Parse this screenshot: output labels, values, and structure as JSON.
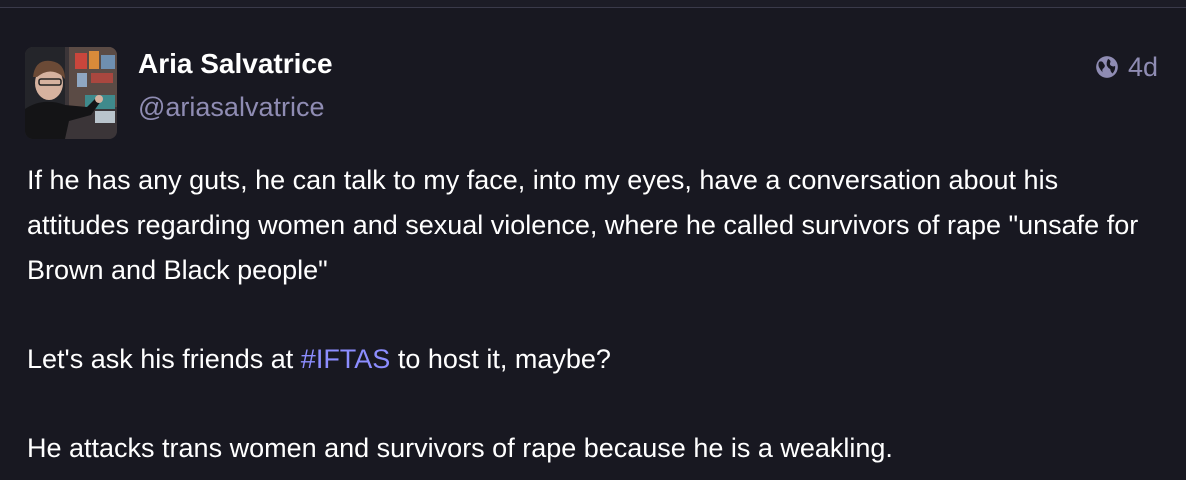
{
  "account": {
    "display_name": "Aria Salvatrice",
    "handle": "@ariasalvatrice"
  },
  "meta": {
    "visibility_icon": "globe-icon",
    "relative_time": "4d"
  },
  "post": {
    "paragraph_1": "If he has any guts, he can talk to my face, into my eyes, have a conversation about his attitudes regarding women and sexual violence, where he called survivors of rape \"unsafe for Brown and Black people\"",
    "paragraph_2_before": "Let's ask his friends at ",
    "hashtag": "#IFTAS",
    "paragraph_2_after": " to host it, maybe?",
    "paragraph_3": "He attacks trans women and survivors of rape because he is a weakling."
  },
  "colors": {
    "background": "#181821",
    "secondary_text": "#8f8cb3",
    "hashtag": "#8c8dff"
  }
}
